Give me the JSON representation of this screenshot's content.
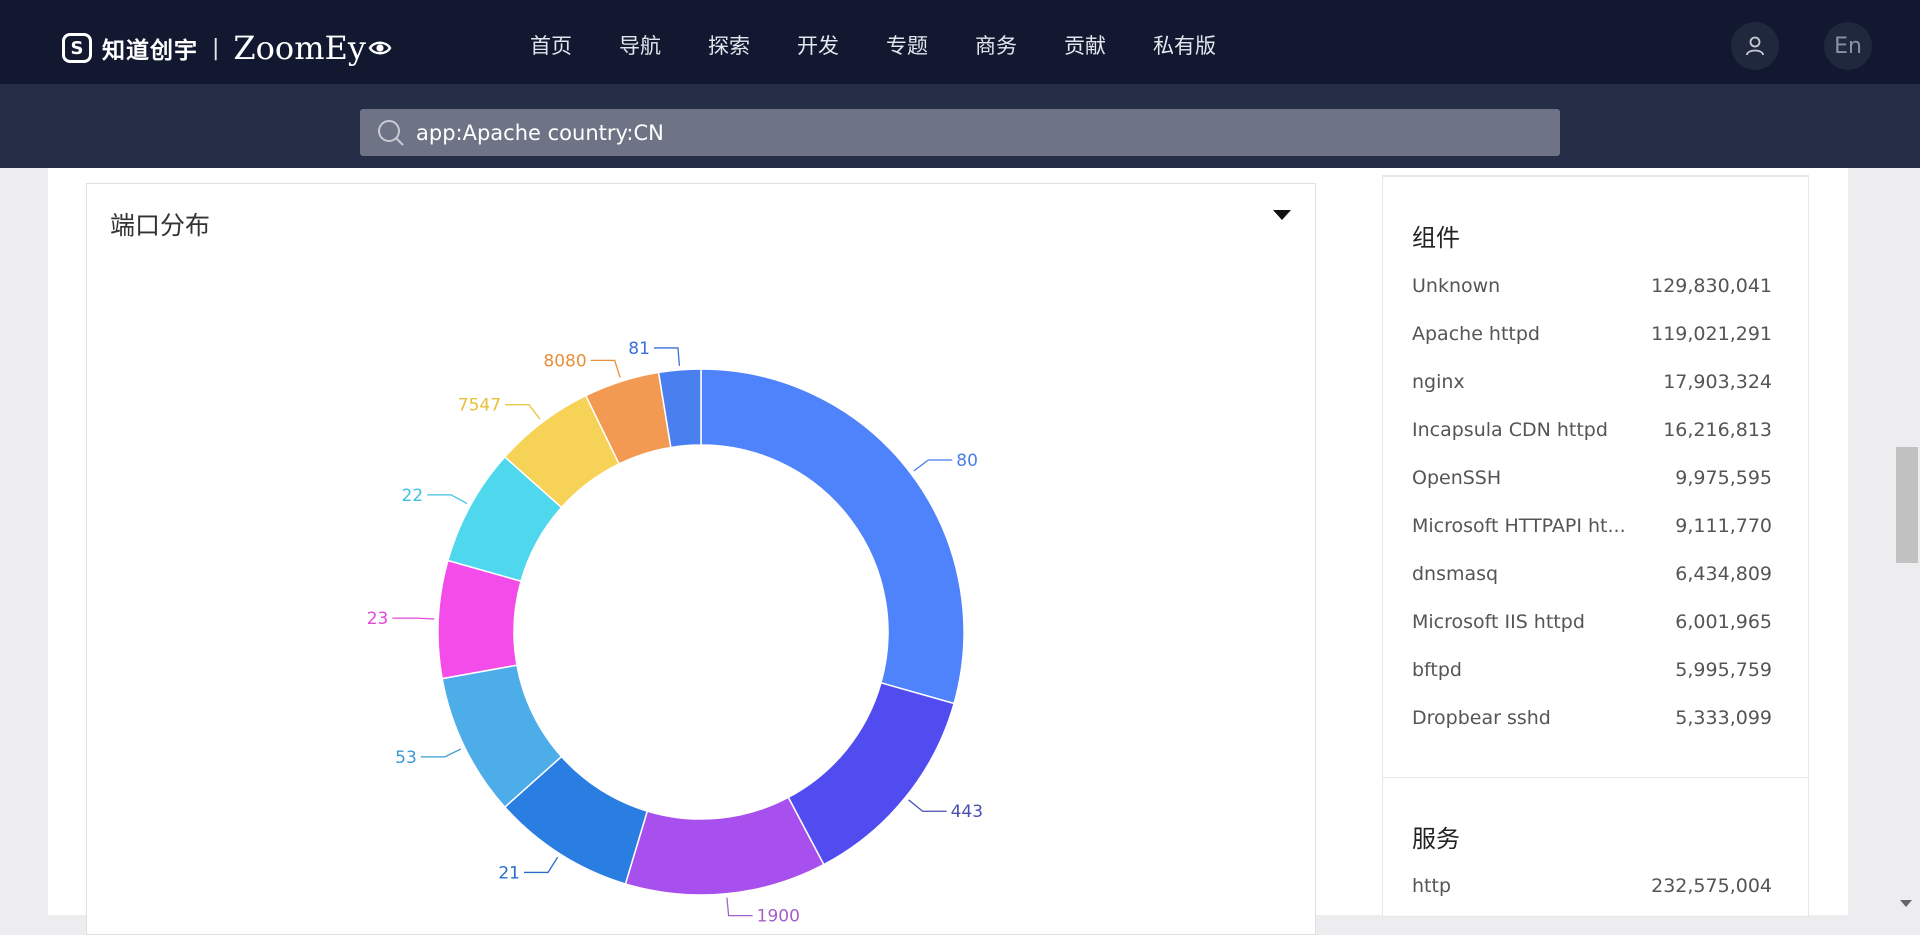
{
  "header": {
    "logo_mark": "S",
    "logo_cn": "知道创宇",
    "logo_sep": "|",
    "logo_en": "ZoomEy",
    "nav": [
      "首页",
      "导航",
      "探索",
      "开发",
      "专题",
      "商务",
      "贡献",
      "私有版"
    ],
    "lang_label": "En"
  },
  "search": {
    "query": "app:Apache country:CN"
  },
  "port_card": {
    "title": "端口分布",
    "chart_data": {
      "type": "pie",
      "donut": true,
      "categories": [
        "80",
        "443",
        "1900",
        "21",
        "53",
        "23",
        "22",
        "7547",
        "8080",
        "81"
      ],
      "values": [
        28.5,
        12.5,
        12.0,
        8.5,
        8.5,
        7.0,
        7.0,
        6.0,
        4.5,
        2.5
      ],
      "colors": [
        "#4f83fb",
        "#514cef",
        "#a850ee",
        "#2a7de1",
        "#4cade9",
        "#f34ce9",
        "#4fd7ee",
        "#f6d356",
        "#f39a52",
        "#4a7ff0"
      ],
      "label_colors": [
        "#4a7de9",
        "#4a4fb0",
        "#a560c8",
        "#2a6cc8",
        "#3a9ad6",
        "#e04ad8",
        "#3cc2e0",
        "#e8c03a",
        "#e88f3a",
        "#3a6fd8"
      ]
    }
  },
  "components": {
    "title": "组件",
    "items": [
      {
        "name": "Unknown",
        "value": "129,830,041"
      },
      {
        "name": "Apache httpd",
        "value": "119,021,291"
      },
      {
        "name": "nginx",
        "value": "17,903,324"
      },
      {
        "name": "Incapsula CDN httpd",
        "value": "16,216,813"
      },
      {
        "name": "OpenSSH",
        "value": "9,975,595"
      },
      {
        "name": "Microsoft HTTPAPI ht...",
        "value": "9,111,770"
      },
      {
        "name": "dnsmasq",
        "value": "6,434,809"
      },
      {
        "name": "Microsoft IIS httpd",
        "value": "6,001,965"
      },
      {
        "name": "bftpd",
        "value": "5,995,759"
      },
      {
        "name": "Dropbear sshd",
        "value": "5,333,099"
      }
    ]
  },
  "services": {
    "title": "服务",
    "items": [
      {
        "name": "http",
        "value": "232,575,004"
      }
    ]
  }
}
